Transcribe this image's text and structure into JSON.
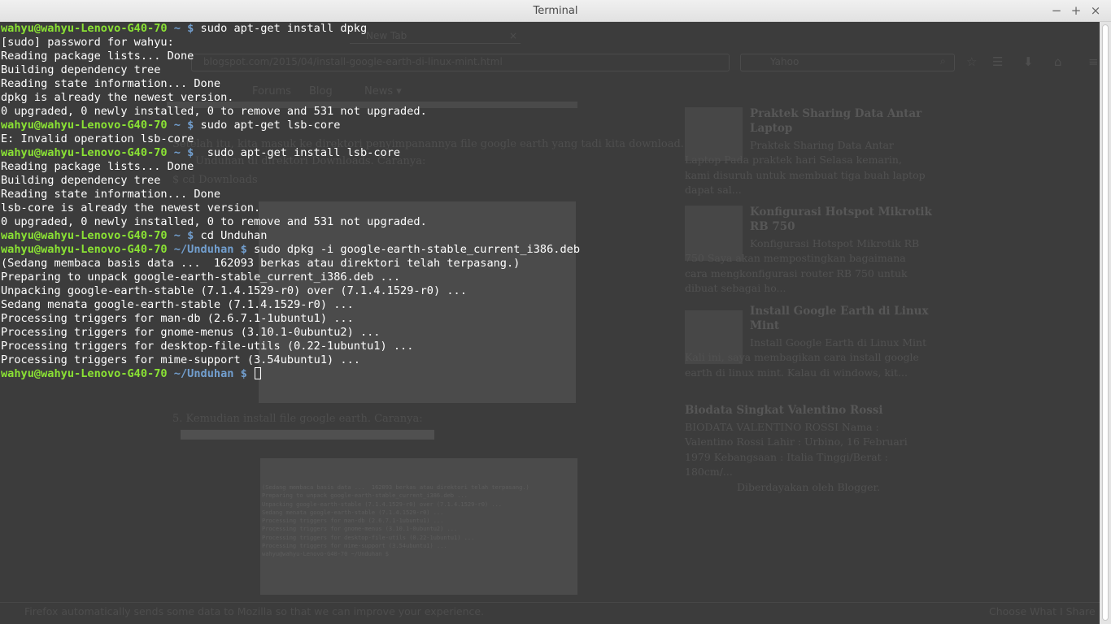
{
  "window": {
    "title": "Terminal",
    "controls": {
      "minimize": "−",
      "maximize": "+",
      "close": "×"
    }
  },
  "terminal": {
    "prompt_user": "wahyu@wahyu-Lenovo-G40-70",
    "lines": [
      {
        "path": "~ $",
        "cmd": " sudo apt-get install dpkg"
      },
      {
        "text": "[sudo] password for wahyu:"
      },
      {
        "text": "Reading package lists... Done"
      },
      {
        "text": "Building dependency tree"
      },
      {
        "text": "Reading state information... Done"
      },
      {
        "text": "dpkg is already the newest version."
      },
      {
        "text": "0 upgraded, 0 newly installed, 0 to remove and 531 not upgraded."
      },
      {
        "path": "~ $",
        "cmd": " sudo apt-get lsb-core"
      },
      {
        "text": "E: Invalid operation lsb-core"
      },
      {
        "path": "~ $",
        "cmd": "  sudo apt-get install lsb-core"
      },
      {
        "text": "Reading package lists... Done"
      },
      {
        "text": "Building dependency tree"
      },
      {
        "text": "Reading state information... Done"
      },
      {
        "text": "lsb-core is already the newest version."
      },
      {
        "text": "0 upgraded, 0 newly installed, 0 to remove and 531 not upgraded."
      },
      {
        "path": "~ $",
        "cmd": " cd Unduhan"
      },
      {
        "path": "~/Unduhan $",
        "cmd": " sudo dpkg -i google-earth-stable_current_i386.deb"
      },
      {
        "text": "(Sedang membaca basis data ...  162093 berkas atau direktori telah terpasang.)"
      },
      {
        "text": "Preparing to unpack google-earth-stable_current_i386.deb ..."
      },
      {
        "text": "Unpacking google-earth-stable (7.1.4.1529-r0) over (7.1.4.1529-r0) ..."
      },
      {
        "text": "Sedang menata google-earth-stable (7.1.4.1529-r0) ..."
      },
      {
        "text": "Processing triggers for man-db (2.6.7.1-1ubuntu1) ..."
      },
      {
        "text": "Processing triggers for gnome-menus (3.10.1-0ubuntu2) ..."
      },
      {
        "text": "Processing triggers for desktop-file-utils (0.22-1ubuntu1) ..."
      },
      {
        "text": "Processing triggers for mime-support (3.54ubuntu1) ..."
      },
      {
        "path": "~/Unduhan $",
        "cmd": " ",
        "cursor": true
      }
    ]
  },
  "background_browser": {
    "tab_title": "New Tab",
    "tab_close": "×",
    "url": "blogspot.com/2015/04/install-google-earth-di-linux-mint.html",
    "search_placeholder": "Yahoo",
    "bookmarks": [
      "Forums",
      "Blog",
      "News ▾"
    ],
    "article": {
      "step4_text": "Setelah itu, kita masuk ke direktori penyimpanannya file google earth yang tadi kita download.",
      "step4_text2": "Unduhan di direktori Downloads. Caranya:",
      "downloads_label": "$ cd Downloads",
      "step5_text": "5. Kemudian install file google earth. Caranya:",
      "mini_terminal": "(Sedang membaca basis data ...  162093 berkas atau direktori telah terpasang.)\nPreparing to unpack google-earth-stable_current_i386.deb ...\nUnpacking google-earth-stable (7.1.4.1529-r0) over (7.1.4.1529-r0) ...\nSedang menata google-earth-stable (7.1.4.1529-r0) ...\nProcessing triggers for man-db (2.6.7.1-1ubuntu1) ...\nProcessing triggers for gnome-menus (3.10.1-0ubuntu2) ...\nProcessing triggers for desktop-file-utils (0.22-1ubuntu1) ...\nProcessing triggers for mime-support (3.54ubuntu1) ...\nwahyu@wahyu-Lenovo-G40-70 ~/Unduhan $"
    },
    "sidebar": [
      {
        "title": "Praktek Sharing Data Antar Laptop",
        "snippet": "Praktek Sharing Data Antar Laptop          Pada praktek hari Selasa kemarin, kami disuruh untuk membuat tiga buah laptop dapat sal..."
      },
      {
        "title": "Konfigurasi Hotspot Mikrotik RB 750",
        "snippet": " Konfigurasi Hotspot Mikrotik RB 750 Saya akan mempostingkan bagaimana cara mengkonfigurasi router RB 750 untuk dibuat sebagai ho..."
      },
      {
        "title": "Install Google Earth di Linux Mint",
        "snippet": "Install Google Earth di Linux Mint Kali ini, saya membagikan cara install google earth di linux mint. Kalau di windows, kit..."
      },
      {
        "title": "Biodata Singkat Valentino Rossi",
        "snippet": "BIODATA VALENTINO ROSSI   Nama : Valentino Rossi Lahir : Urbino, 16 Februari 1979 Kebangsaan : Italia Tinggi/Berat : 180cm/..."
      }
    ],
    "powered_by": "Diberdayakan oleh Blogger.",
    "notice": "Firefox automatically sends some data to Mozilla so that we can improve your experience.",
    "notice_button": "Choose What I Share"
  }
}
